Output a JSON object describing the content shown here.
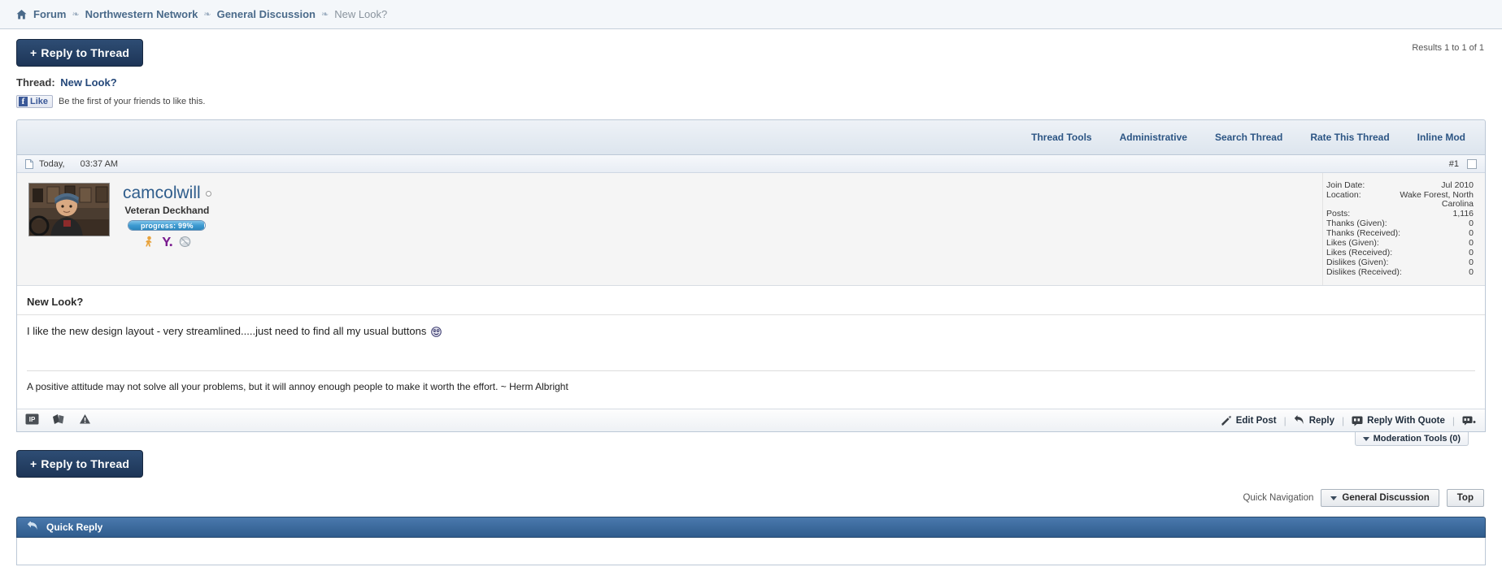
{
  "breadcrumb": {
    "home_icon": "home-icon",
    "items": [
      {
        "label": "Forum",
        "last": false
      },
      {
        "label": "Northwestern Network",
        "last": false
      },
      {
        "label": "General Discussion",
        "last": false
      },
      {
        "label": "New Look?",
        "last": true
      }
    ],
    "separator": "❧"
  },
  "toolbar": {
    "reply_label": "Reply to Thread",
    "plus": "+",
    "results_count": "Results 1 to 1 of 1"
  },
  "thread": {
    "label": "Thread:",
    "name": "New Look?"
  },
  "facebook": {
    "f_glyph": "f",
    "like_label": "Like",
    "caption": "Be the first of your friends to like this."
  },
  "thread_tools": [
    {
      "label": "Thread Tools"
    },
    {
      "label": "Administrative"
    },
    {
      "label": "Search Thread"
    },
    {
      "label": "Rate This Thread"
    },
    {
      "label": "Inline Mod"
    }
  ],
  "post": {
    "date": "Today,",
    "time": "03:37 AM",
    "number": "#1",
    "title": "New Look?",
    "body": "I like the new design layout - very streamlined.....just need to find all my usual buttons",
    "emoticon": "smiley-emoticon",
    "signature": "A positive attitude may not solve all your problems, but it will annoy enough people to make it worth the effort. ~ Herm Albright"
  },
  "user": {
    "name": "camcolwill",
    "title": "Veteran Deckhand",
    "online_status": "offline",
    "progress_label": "progress: 99%",
    "progress_percent": 99,
    "contact_icons": [
      {
        "name": "aim-icon"
      },
      {
        "name": "yahoo-messenger-icon"
      },
      {
        "name": "msn-messenger-icon"
      }
    ],
    "stats": [
      {
        "label": "Join Date:",
        "value": "Jul 2010"
      },
      {
        "label": "Location:",
        "value": "Wake Forest, North Carolina"
      },
      {
        "label": "Posts:",
        "value": "1,116"
      },
      {
        "label": "Thanks (Given):",
        "value": "0"
      },
      {
        "label": "Thanks (Received):",
        "value": "0"
      },
      {
        "label": "Likes (Given):",
        "value": "0"
      },
      {
        "label": "Likes (Received):",
        "value": "0"
      },
      {
        "label": "Dislikes (Given):",
        "value": "0"
      },
      {
        "label": "Dislikes (Received):",
        "value": "0"
      }
    ]
  },
  "post_footer": {
    "left_icons": [
      {
        "name": "ip-address-icon",
        "label": "IP"
      },
      {
        "name": "thanks-cards-icon"
      },
      {
        "name": "report-warning-icon"
      }
    ],
    "actions": [
      {
        "label": "Edit Post",
        "icon": "pencil-icon"
      },
      {
        "label": "Reply",
        "icon": "reply-arrow-icon"
      },
      {
        "label": "Reply With Quote",
        "icon": "quote-bubble-icon"
      }
    ],
    "multiquote_icon": "multiquote-icon",
    "separator": "|",
    "moderation_tools": "Moderation Tools (0)"
  },
  "quick_navigation": {
    "label": "Quick Navigation",
    "selected_forum": "General Discussion",
    "top_label": "Top"
  },
  "quick_reply": {
    "title": "Quick Reply",
    "icon": "quick-reply-icon"
  },
  "colors": {
    "accent_blue": "#2c5584",
    "button_dark": "#1d3557",
    "facebook_blue": "#3b5998",
    "bar_blue": "#2f5c8d"
  }
}
